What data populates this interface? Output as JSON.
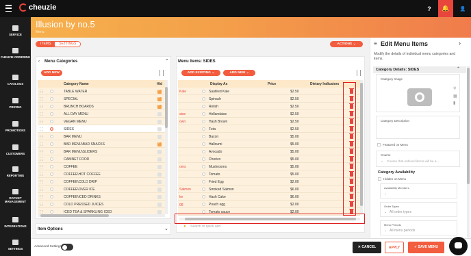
{
  "topbar": {
    "logo_text": "cheuzie",
    "help": "?",
    "bell": "🔔",
    "user": "👤"
  },
  "sidebar": {
    "items": [
      {
        "label": "SERVICE",
        "icon": "service-icon"
      },
      {
        "label": "CHEUZIE ORDERING",
        "icon": "ordering-icon"
      },
      {
        "label": "CATALOGS",
        "icon": "catalogs-icon"
      },
      {
        "label": "PRICING",
        "icon": "pricing-icon"
      },
      {
        "label": "PROMOTIONS",
        "icon": "promotions-icon"
      },
      {
        "label": "CUSTOMERS",
        "icon": "customers-icon"
      },
      {
        "label": "REPORTING",
        "icon": "reporting-icon"
      },
      {
        "label": "DOCKET MANAGEMENT",
        "icon": "docket-icon"
      },
      {
        "label": "INTEGRATIONS",
        "icon": "integrations-icon"
      },
      {
        "label": "SETTINGS",
        "icon": "settings-icon"
      }
    ]
  },
  "header": {
    "title": "Illusion by no.5",
    "subtitle": "Menu"
  },
  "tabs": {
    "items": "ITEMS",
    "settings": "SETTINGS"
  },
  "actions_label": "ACTIONS",
  "categories": {
    "title": "Menu Categories",
    "add_new": "ADD NEW",
    "col_name": "Category Name",
    "col_hide": "Hid",
    "rows": [
      {
        "name": "TABLE WATER",
        "hidden": true,
        "selected": false
      },
      {
        "name": "SPECIAL",
        "hidden": true,
        "selected": false
      },
      {
        "name": "BRUNCH BOARDS",
        "hidden": true,
        "selected": false
      },
      {
        "name": "ALL DAY MENU",
        "hidden": false,
        "selected": false
      },
      {
        "name": "VEGAN MENU",
        "hidden": false,
        "selected": false
      },
      {
        "name": "SIDES",
        "hidden": false,
        "selected": true
      },
      {
        "name": "BAR MENU",
        "hidden": false,
        "selected": false
      },
      {
        "name": "BAR MENU\\BAR SNACKS",
        "hidden": true,
        "selected": false
      },
      {
        "name": "BAR MENU\\SLIDERS",
        "hidden": false,
        "selected": false
      },
      {
        "name": "CABINET FOOD",
        "hidden": false,
        "selected": false
      },
      {
        "name": "COFFEE",
        "hidden": false,
        "selected": false
      },
      {
        "name": "COFFEE\\HOT COFFEE",
        "hidden": false,
        "selected": false
      },
      {
        "name": "COFFEE\\COLD DRIP",
        "hidden": false,
        "selected": false
      },
      {
        "name": "COFFEE\\OVER ICE",
        "hidden": false,
        "selected": false
      },
      {
        "name": "COFFEE\\ICED DRINKS",
        "hidden": false,
        "selected": false
      },
      {
        "name": "COLD PRESSED JUICES",
        "hidden": false,
        "selected": false
      },
      {
        "name": "ICED TEA & SPARKLING ICED",
        "hidden": false,
        "selected": false
      }
    ],
    "item_options": "Item Options"
  },
  "menu_items": {
    "title": "Menu Items: SIDES",
    "add_existing": "ADD EXISTING",
    "add_new": "ADD NEW",
    "col_display": "Display As",
    "col_price": "Price",
    "col_dietary": "Dietary Indicators",
    "rows": [
      {
        "prefix": "Kale",
        "display": "Sautéed Kale",
        "price": "$2.50"
      },
      {
        "prefix": "",
        "display": "Spinach",
        "price": "$2.50"
      },
      {
        "prefix": "",
        "display": "Relish",
        "price": "$2.50"
      },
      {
        "prefix": "aise",
        "display": "Hollandaise",
        "price": "$2.50"
      },
      {
        "prefix": "own",
        "display": "Hash Brown",
        "price": "$2.50"
      },
      {
        "prefix": "",
        "display": "Feta",
        "price": "$2.50"
      },
      {
        "prefix": "",
        "display": "Bacon",
        "price": "$5.00"
      },
      {
        "prefix": "",
        "display": "Halloumi",
        "price": "$5.00"
      },
      {
        "prefix": "",
        "display": "Avocado",
        "price": "$5.00"
      },
      {
        "prefix": "",
        "display": "Chorizo",
        "price": "$5.00"
      },
      {
        "prefix": "oms",
        "display": "Mushrooms",
        "price": "$5.00"
      },
      {
        "prefix": "",
        "display": "Tomato",
        "price": "$5.00"
      },
      {
        "prefix": "",
        "display": "Fried Egg",
        "price": "$2.00"
      },
      {
        "prefix": "Salmon",
        "display": "Smoked Salmon",
        "price": "$6.00"
      },
      {
        "prefix": "ke",
        "display": "Hash Cake",
        "price": "$6.00"
      },
      {
        "prefix": "gg",
        "display": "Poach egg",
        "price": "$2.00"
      },
      {
        "prefix": "",
        "display": "Tomato sauce",
        "price": "$2.00"
      }
    ],
    "quick_add_placeholder": "Search to quick add"
  },
  "edit_panel": {
    "title": "Edit Menu Items",
    "description": "Modify the details of individual menu categories and items.",
    "details_title": "Category Details: SIDES",
    "image_label": "Category Image",
    "desc_label": "Category Description",
    "featured_label": "Featured on Menu",
    "course_label": "Course",
    "course_placeholder": "Course that ordered items will be a...",
    "availability_title": "Category Availability",
    "hidden_label": "Hidden on Menu",
    "avail_members_label": "Availability Members",
    "order_types_label": "Order Types",
    "order_types_value": "All order types",
    "menu_periods_label": "Menu Periods",
    "menu_periods_value": "All menu periods"
  },
  "footer": {
    "advanced": "Advanced Settings",
    "cancel": "CANCEL",
    "apply": "APPLY",
    "save": "SAVE MENU"
  },
  "colors": {
    "accent": "#f25c3f",
    "header_start": "#f6b04c",
    "header_end": "#f07c4b",
    "highlight_box": "#e02020"
  }
}
